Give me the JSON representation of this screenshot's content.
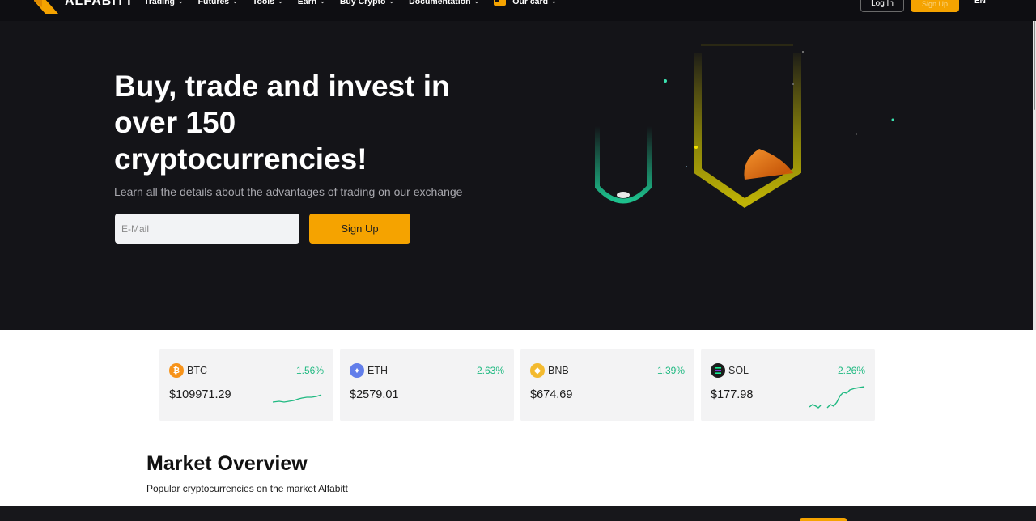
{
  "brand": {
    "name": "ALFABITT",
    "accent": "#f5a300"
  },
  "nav": {
    "items": [
      {
        "label": "Trading"
      },
      {
        "label": "Futures"
      },
      {
        "label": "Tools"
      },
      {
        "label": "Earn"
      },
      {
        "label": "Buy Crypto"
      },
      {
        "label": "Documentation"
      },
      {
        "label": "Our card"
      }
    ],
    "login_label": "Log In",
    "signup_label": "Sign Up",
    "lang": "EN"
  },
  "hero": {
    "title": "Buy, trade and invest in over 150 cryptocurrencies!",
    "subtitle": "Learn all the details about the advantages of trading on our exchange",
    "email_placeholder": "E-Mail",
    "signup_label": "Sign Up"
  },
  "tickers": [
    {
      "symbol": "BTC",
      "change": "1.56%",
      "price": "$109971.29",
      "icon": "bitcoin-icon",
      "color": "#f7931a"
    },
    {
      "symbol": "ETH",
      "change": "2.63%",
      "price": "$2579.01",
      "icon": "ethereum-icon",
      "color": "#627eea"
    },
    {
      "symbol": "BNB",
      "change": "1.39%",
      "price": "$674.69",
      "icon": "bnb-icon",
      "color": "#f3ba2f"
    },
    {
      "symbol": "SOL",
      "change": "2.26%",
      "price": "$177.98",
      "icon": "solana-icon",
      "color": "#1c1c1c"
    }
  ],
  "market": {
    "title": "Market Overview",
    "subtitle": "Popular cryptocurrencies on the market Alfabitt"
  }
}
